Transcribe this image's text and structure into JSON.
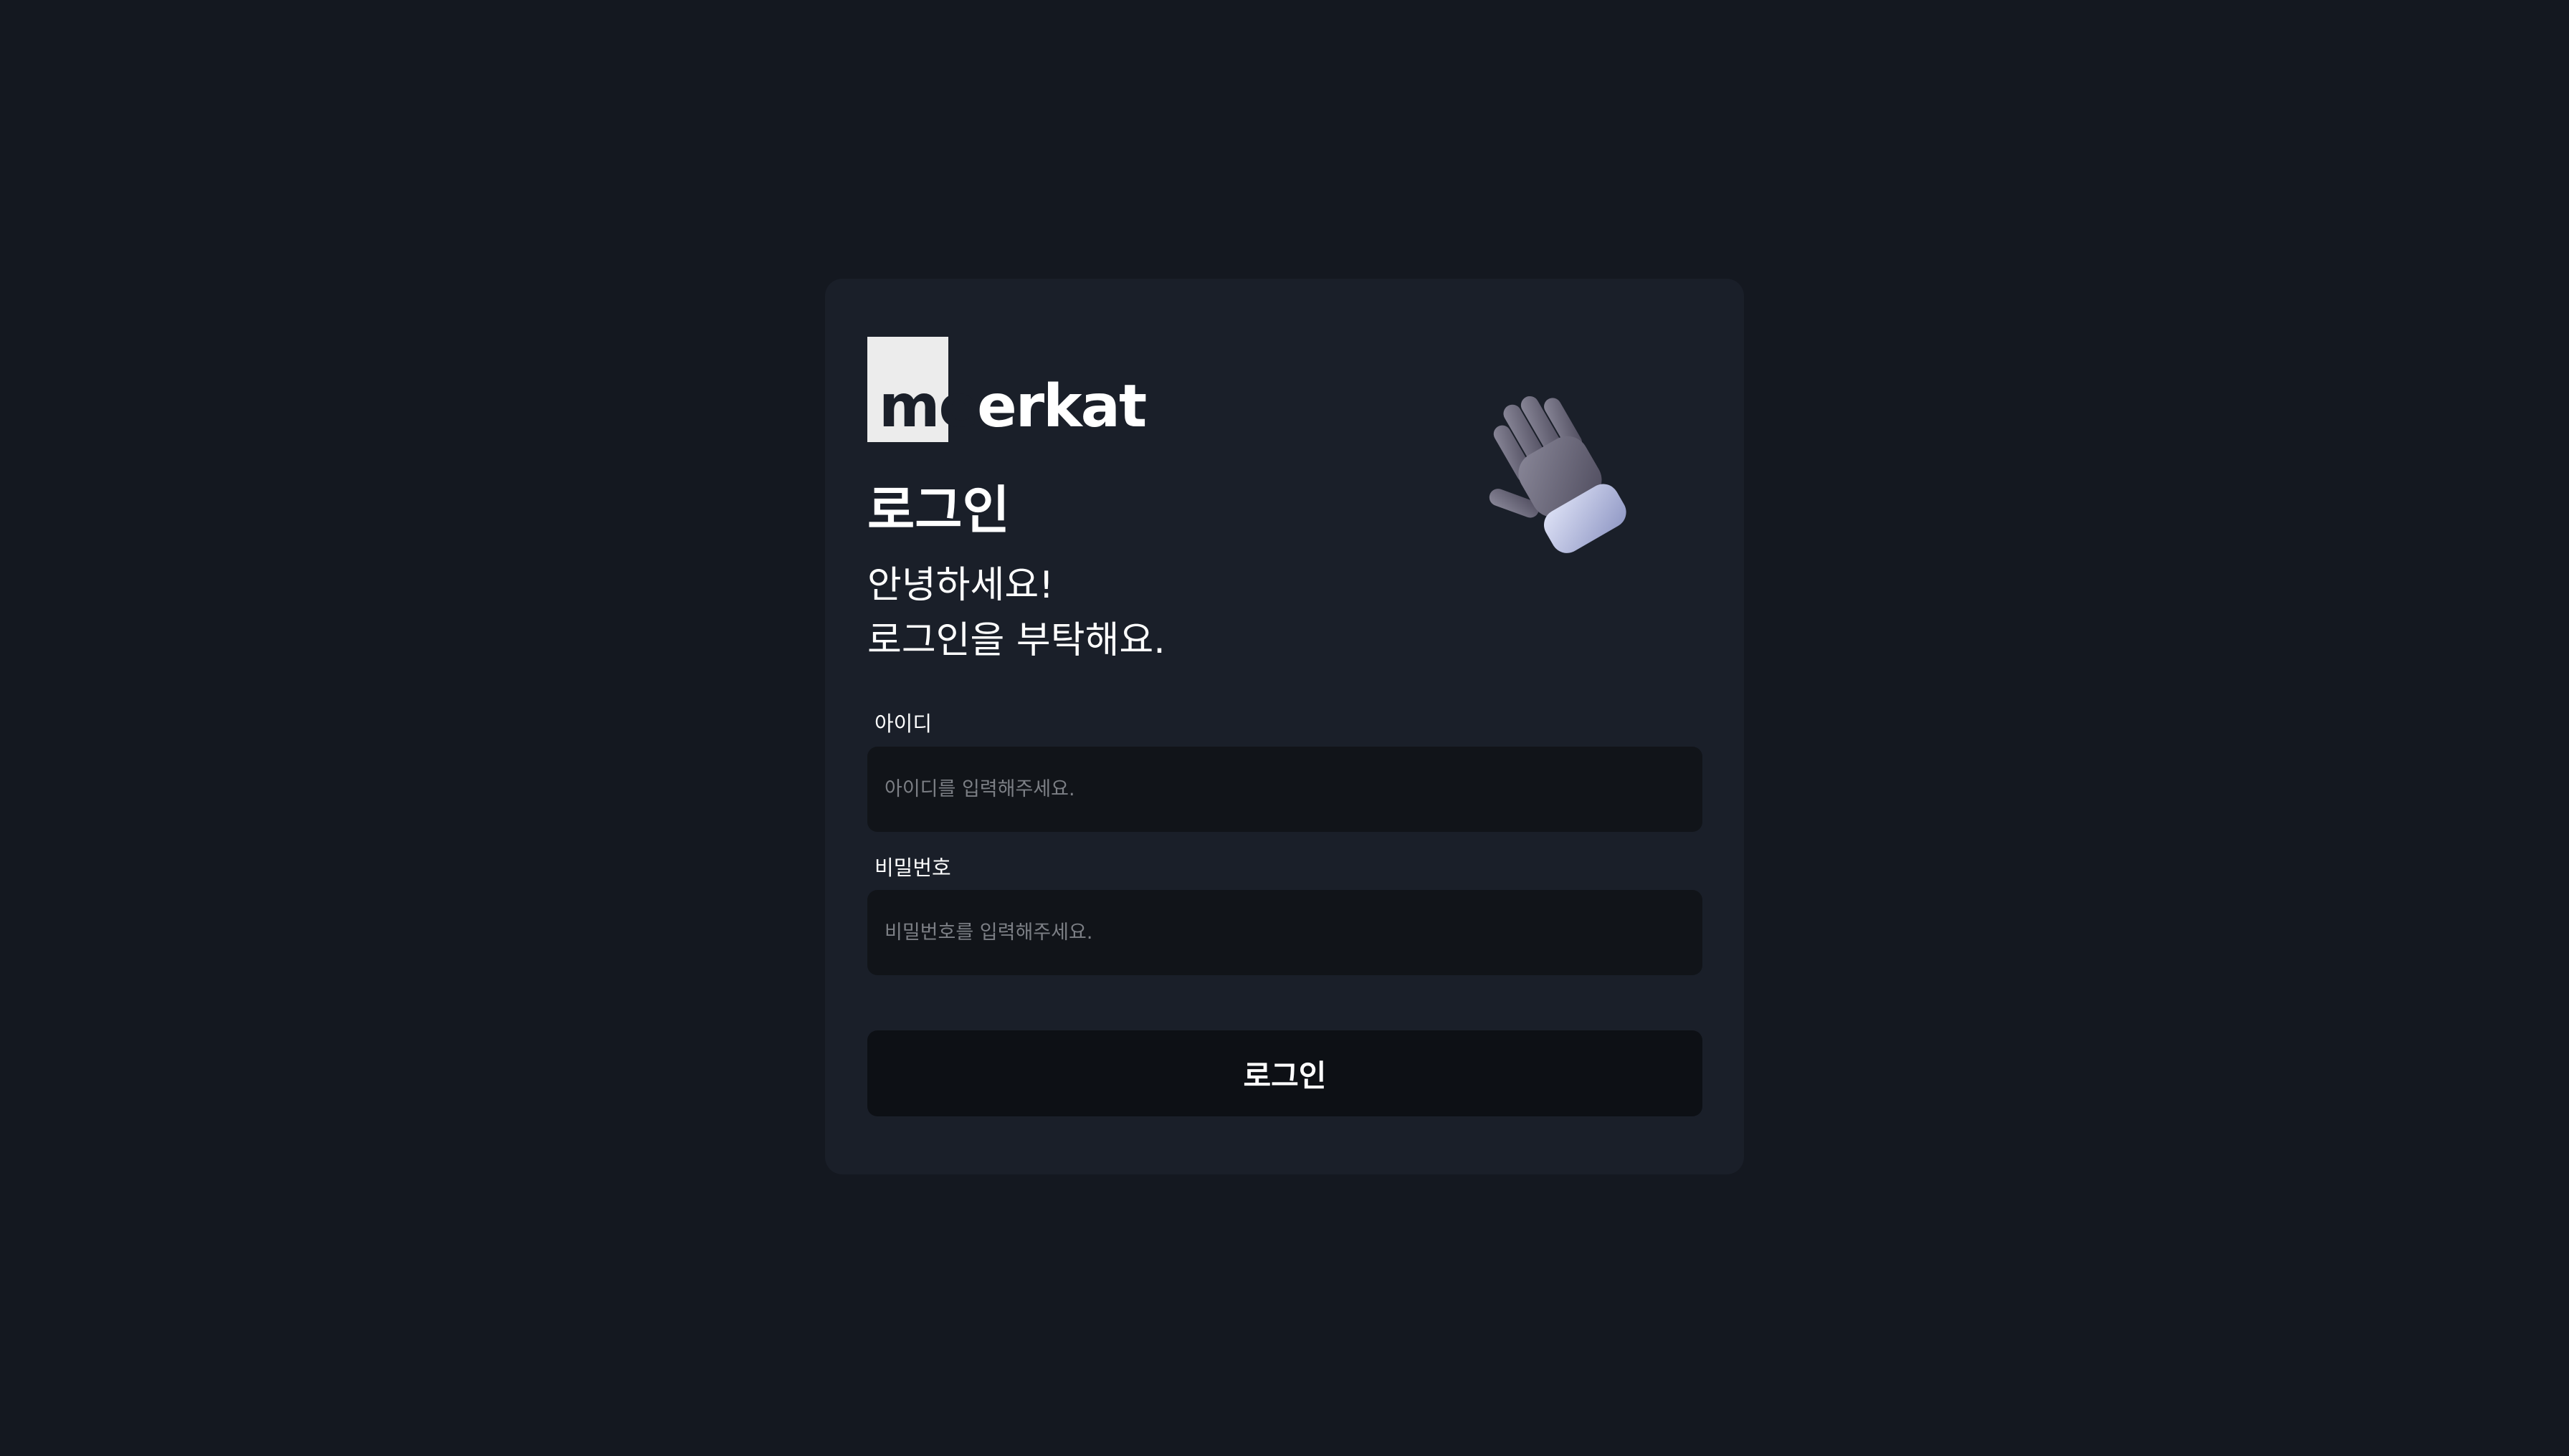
{
  "brand": {
    "logo_text_m": "m",
    "logo_text_e": "e",
    "logo_text_rest": "erkat",
    "logo_full": "meerkat"
  },
  "header": {
    "title": "로그인",
    "greeting_line1": "안녕하세요!",
    "greeting_line2": "로그인을 부탁해요."
  },
  "form": {
    "id_label": "아이디",
    "id_placeholder": "아이디를 입력해주세요.",
    "id_value": "",
    "password_label": "비밀번호",
    "password_placeholder": "비밀번호를 입력해주세요.",
    "password_value": "",
    "submit_label": "로그인"
  },
  "icons": {
    "waving_hand": "waving-hand-icon"
  },
  "colors": {
    "page_background": "#141820",
    "card_background": "#1a1f29",
    "input_background": "#111419",
    "button_background": "#0d1015",
    "placeholder": "#7c7f85",
    "text": "#ffffff"
  }
}
